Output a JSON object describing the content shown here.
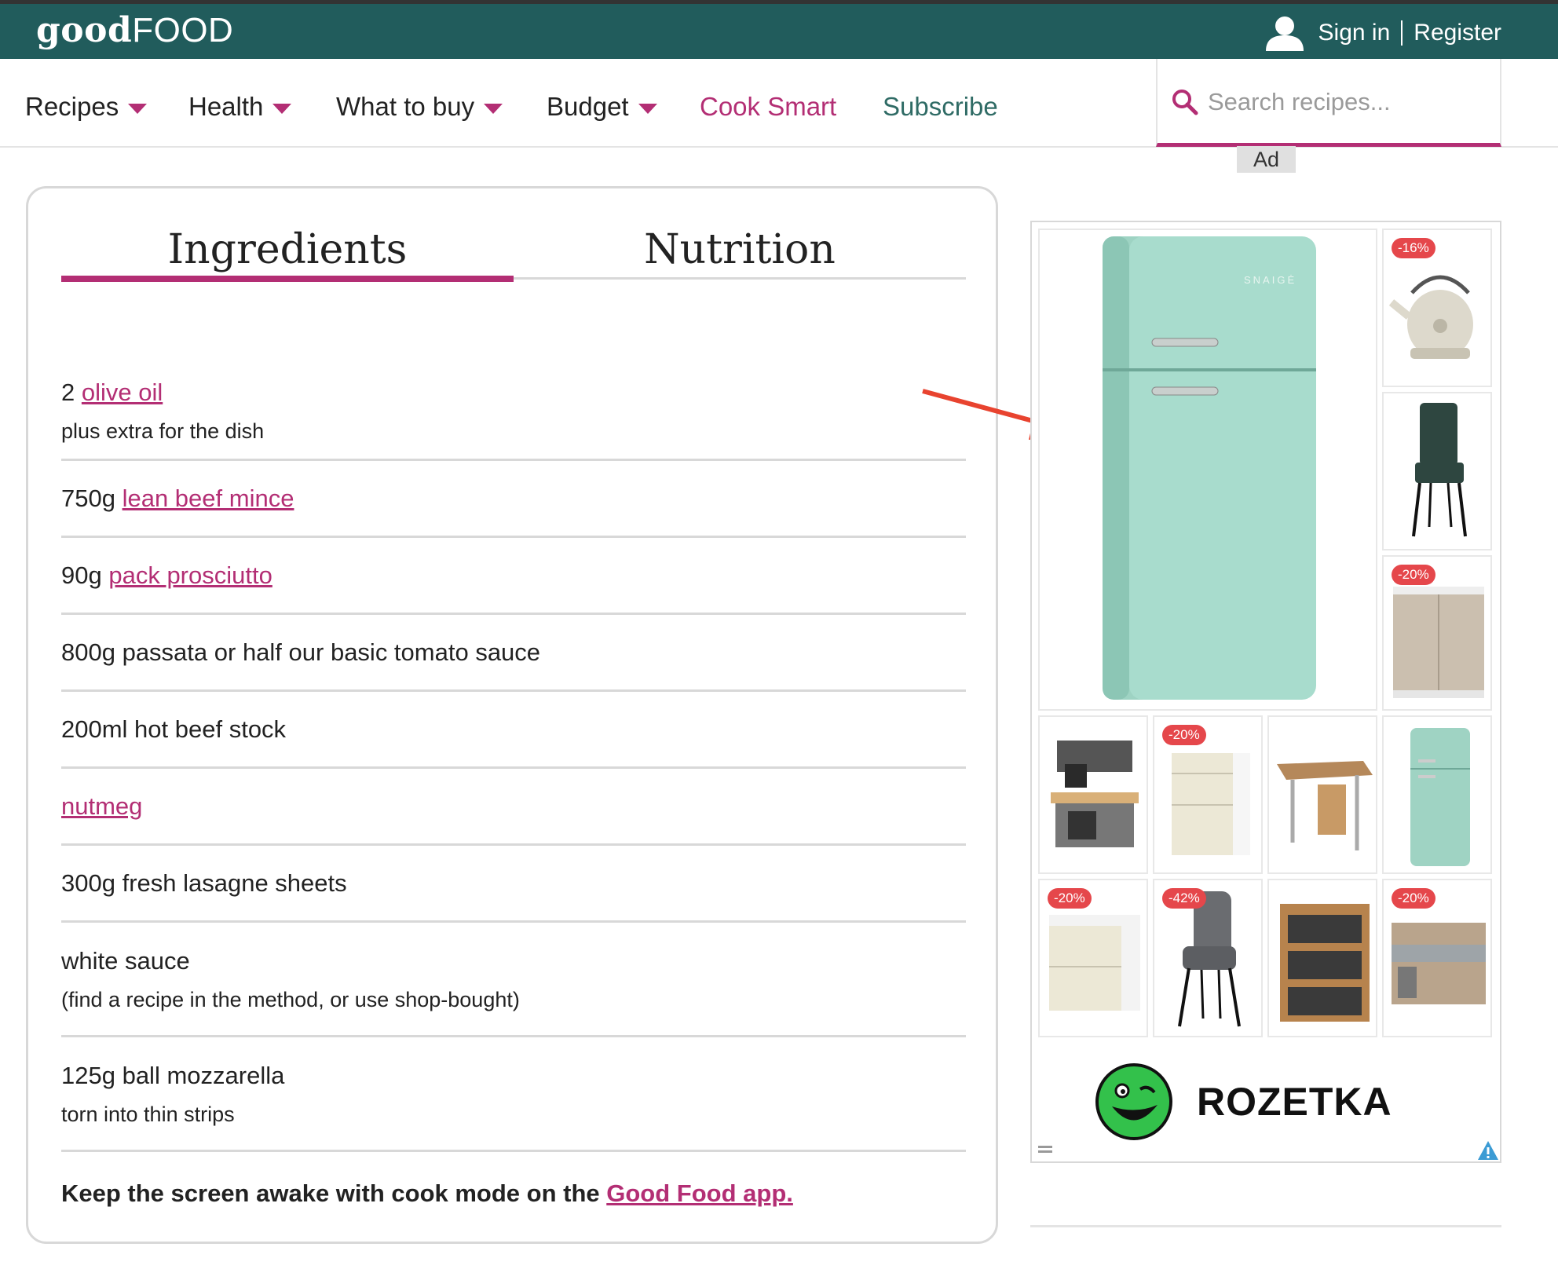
{
  "brand": {
    "logo_bold": "good",
    "logo_light": "FOOD",
    "color_header": "#215c5c",
    "color_accent": "#b32e74"
  },
  "account": {
    "icon": "user-icon",
    "sign_in": "Sign in",
    "register": "Register"
  },
  "nav": {
    "items": [
      {
        "label": "Recipes",
        "dropdown": true
      },
      {
        "label": "Health",
        "dropdown": true
      },
      {
        "label": "What to buy",
        "dropdown": true
      },
      {
        "label": "Budget",
        "dropdown": true
      },
      {
        "label": "Cook Smart",
        "dropdown": false
      },
      {
        "label": "Subscribe",
        "dropdown": false
      }
    ]
  },
  "search": {
    "placeholder": "Search recipes...",
    "icon": "search-icon"
  },
  "ad_label": "Ad",
  "tabs": {
    "ingredients": "Ingredients",
    "nutrition": "Nutrition",
    "active": "Ingredients"
  },
  "ingredients": [
    {
      "prefix": "2 ",
      "link": "olive oil",
      "suffix": "",
      "note": "plus extra for the dish"
    },
    {
      "prefix": "750g ",
      "link": "lean beef mince",
      "suffix": "",
      "note": ""
    },
    {
      "prefix": "90g ",
      "link": "pack prosciutto",
      "suffix": "",
      "note": ""
    },
    {
      "prefix": "800g passata or half our basic tomato sauce",
      "link": "",
      "suffix": "",
      "note": ""
    },
    {
      "prefix": "200ml hot beef stock",
      "link": "",
      "suffix": "",
      "note": ""
    },
    {
      "prefix": "",
      "link": "nutmeg",
      "suffix": "",
      "note": ""
    },
    {
      "prefix": "300g fresh lasagne sheets",
      "link": "",
      "suffix": "",
      "note": ""
    },
    {
      "prefix": "white sauce",
      "link": "",
      "suffix": "",
      "note": "(find a recipe in the method, or use shop-bought)"
    },
    {
      "prefix": "125g ball mozzarella",
      "link": "",
      "suffix": "",
      "note": "torn into thin strips"
    }
  ],
  "cook_mode": {
    "text": "Keep the screen awake with cook mode on the ",
    "link": "Good Food app."
  },
  "ad": {
    "brand": "ROZETKA",
    "fridge_logo": "SNAIGĖ",
    "badges": [
      "-16%",
      "-20%",
      "-20%",
      "-20%",
      "-42%",
      "-20%"
    ]
  }
}
